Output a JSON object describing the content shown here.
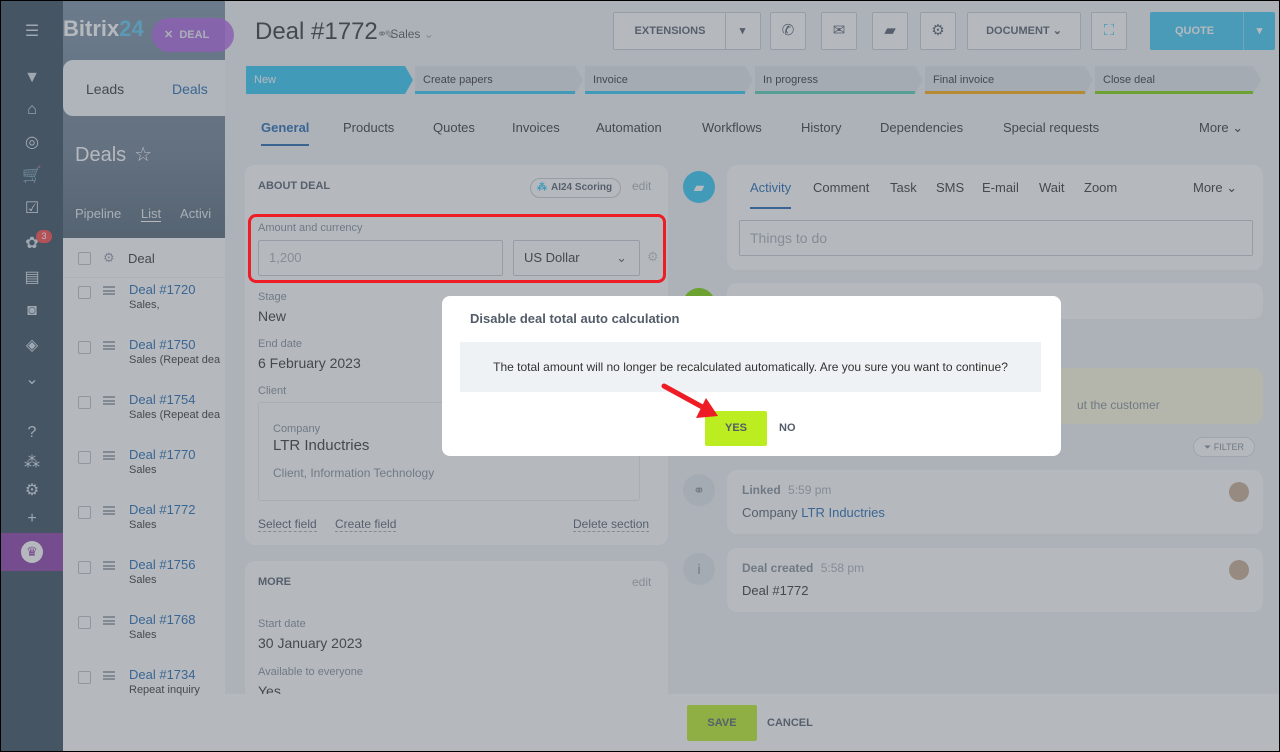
{
  "app": {
    "logo_part1": "Bitrix",
    "logo_part2": "24",
    "deal_badge": "DEAL"
  },
  "left_nav": {
    "tabs": [
      "Leads",
      "Deals"
    ],
    "notification_count": "3",
    "icons": [
      "menu-icon",
      "feed-icon",
      "home-icon",
      "target-icon",
      "cart-icon",
      "task-icon",
      "crm-icon",
      "contact-card-icon",
      "robot-icon",
      "box-icon",
      "chevron-down-icon",
      "help-icon",
      "org-icon",
      "settings-icon",
      "plus-icon",
      "crown-icon"
    ]
  },
  "deals_page": {
    "title": "Deals",
    "subnav": [
      "Pipeline",
      "List",
      "Activi"
    ],
    "list_header": "Deal",
    "rows": [
      {
        "title": "Deal #1720",
        "sub": "Sales,"
      },
      {
        "title": "Deal #1750",
        "sub": "Sales (Repeat dea"
      },
      {
        "title": "Deal #1754",
        "sub": "Sales (Repeat dea"
      },
      {
        "title": "Deal #1770",
        "sub": "Sales"
      },
      {
        "title": "Deal #1772",
        "sub": "Sales"
      },
      {
        "title": "Deal #1756",
        "sub": "Sales"
      },
      {
        "title": "Deal #1768",
        "sub": "Sales"
      },
      {
        "title": "Deal #1734",
        "sub": "Repeat inquiry"
      }
    ]
  },
  "header": {
    "title": "Deal #1772",
    "pipeline": "Sales",
    "extensions": "EXTENSIONS",
    "document": "DOCUMENT",
    "quote": "QUOTE"
  },
  "stages": [
    {
      "label": "New",
      "color": "#2fc6f6"
    },
    {
      "label": "Create papers",
      "color": "#2fc6f6"
    },
    {
      "label": "Invoice",
      "color": "#2fc6f6"
    },
    {
      "label": "In progress",
      "color": "#55d0b6"
    },
    {
      "label": "Final invoice",
      "color": "#ffa900"
    },
    {
      "label": "Close deal",
      "color": "#7bd500"
    }
  ],
  "tabs": [
    "General",
    "Products",
    "Quotes",
    "Invoices",
    "Automation",
    "Workflows",
    "History",
    "Dependencies",
    "Special requests",
    "More"
  ],
  "about_deal": {
    "section_title": "ABOUT DEAL",
    "ai_scoring": "AI24 Scoring",
    "edit": "edit",
    "amount_label": "Amount and currency",
    "amount_value": "1,200",
    "currency": "US Dollar",
    "stage_label": "Stage",
    "stage_value": "New",
    "end_date_label": "End date",
    "end_date_value": "6 February 2023",
    "client_label": "Client",
    "company_label": "Company",
    "company_name": "LTR Inductries",
    "company_desc": "Client, Information Technology",
    "select_field": "Select field",
    "create_field": "Create field",
    "delete_section": "Delete section"
  },
  "more_section": {
    "title": "MORE",
    "edit": "edit",
    "start_date_label": "Start date",
    "start_date_value": "30 January 2023",
    "available_label": "Available to everyone",
    "available_value": "Yes"
  },
  "activity": {
    "tabs": [
      "Activity",
      "Comment",
      "Task",
      "SMS",
      "E-mail",
      "Wait",
      "Zoom",
      "More"
    ],
    "placeholder": "Things to do",
    "customer_note_fragment": "ut the customer",
    "filter": "FILTER",
    "linked_title": "Linked",
    "linked_time": "5:59 pm",
    "linked_company_prefix": "Company",
    "linked_company": "LTR Inductries",
    "created_title": "Deal created",
    "created_time": "5:58 pm",
    "created_deal": "Deal #1772"
  },
  "footer": {
    "save": "SAVE",
    "cancel": "CANCEL"
  },
  "dialog": {
    "title": "Disable deal total auto calculation",
    "message": "The total amount will no longer be recalculated automatically. Are you sure you want to continue?",
    "yes": "YES",
    "no": "NO"
  },
  "colors": {
    "accent": "#2067b0",
    "primary_button": "#bbed21",
    "highlight": "#ee1c25",
    "stage_current": "#2fc6f6"
  }
}
